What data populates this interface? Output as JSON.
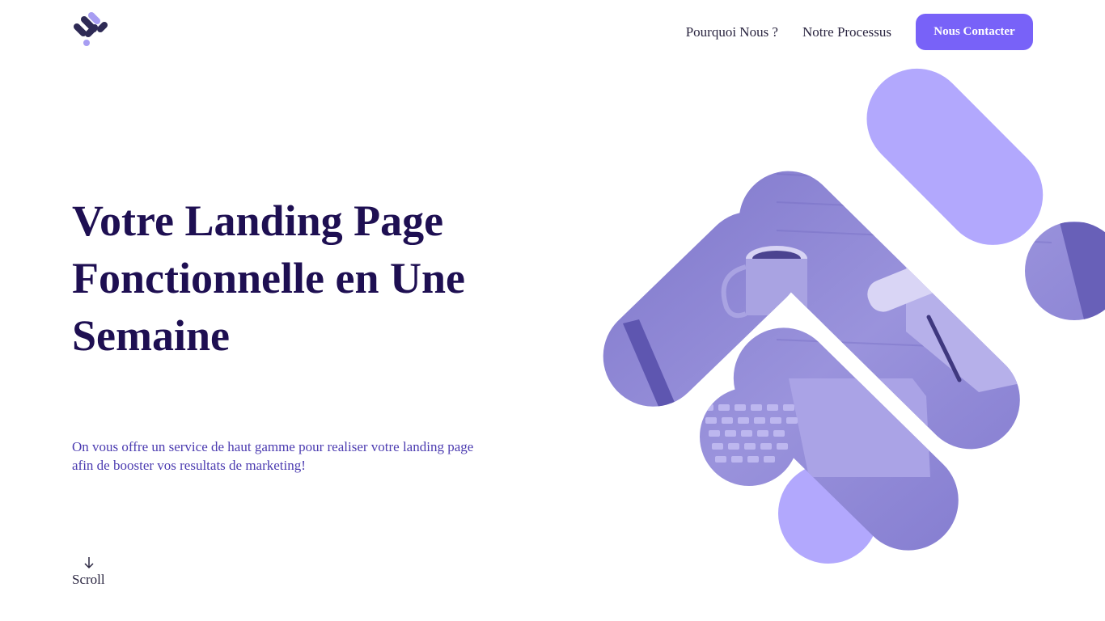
{
  "header": {
    "logo_icon": "stacked-pills-logo",
    "nav": [
      {
        "label": "Pourquoi Nous ?"
      },
      {
        "label": "Notre Processus"
      }
    ],
    "cta_label": "Nous Contacter"
  },
  "hero": {
    "title": "Votre Landing Page Fonctionnelle en Une Semaine",
    "subtitle": "On vous offre un service de haut gamme pour realiser votre landing page afin de booster vos resultats de marketing!",
    "scroll_label": "Scroll",
    "scroll_icon": "arrow-down-icon"
  },
  "colors": {
    "accent": "#7862f8",
    "heading": "#1e0f52",
    "subtitle": "#4b3bb0",
    "shape_light": "#b2a8fd",
    "photo_tint": "#8e86d6"
  }
}
